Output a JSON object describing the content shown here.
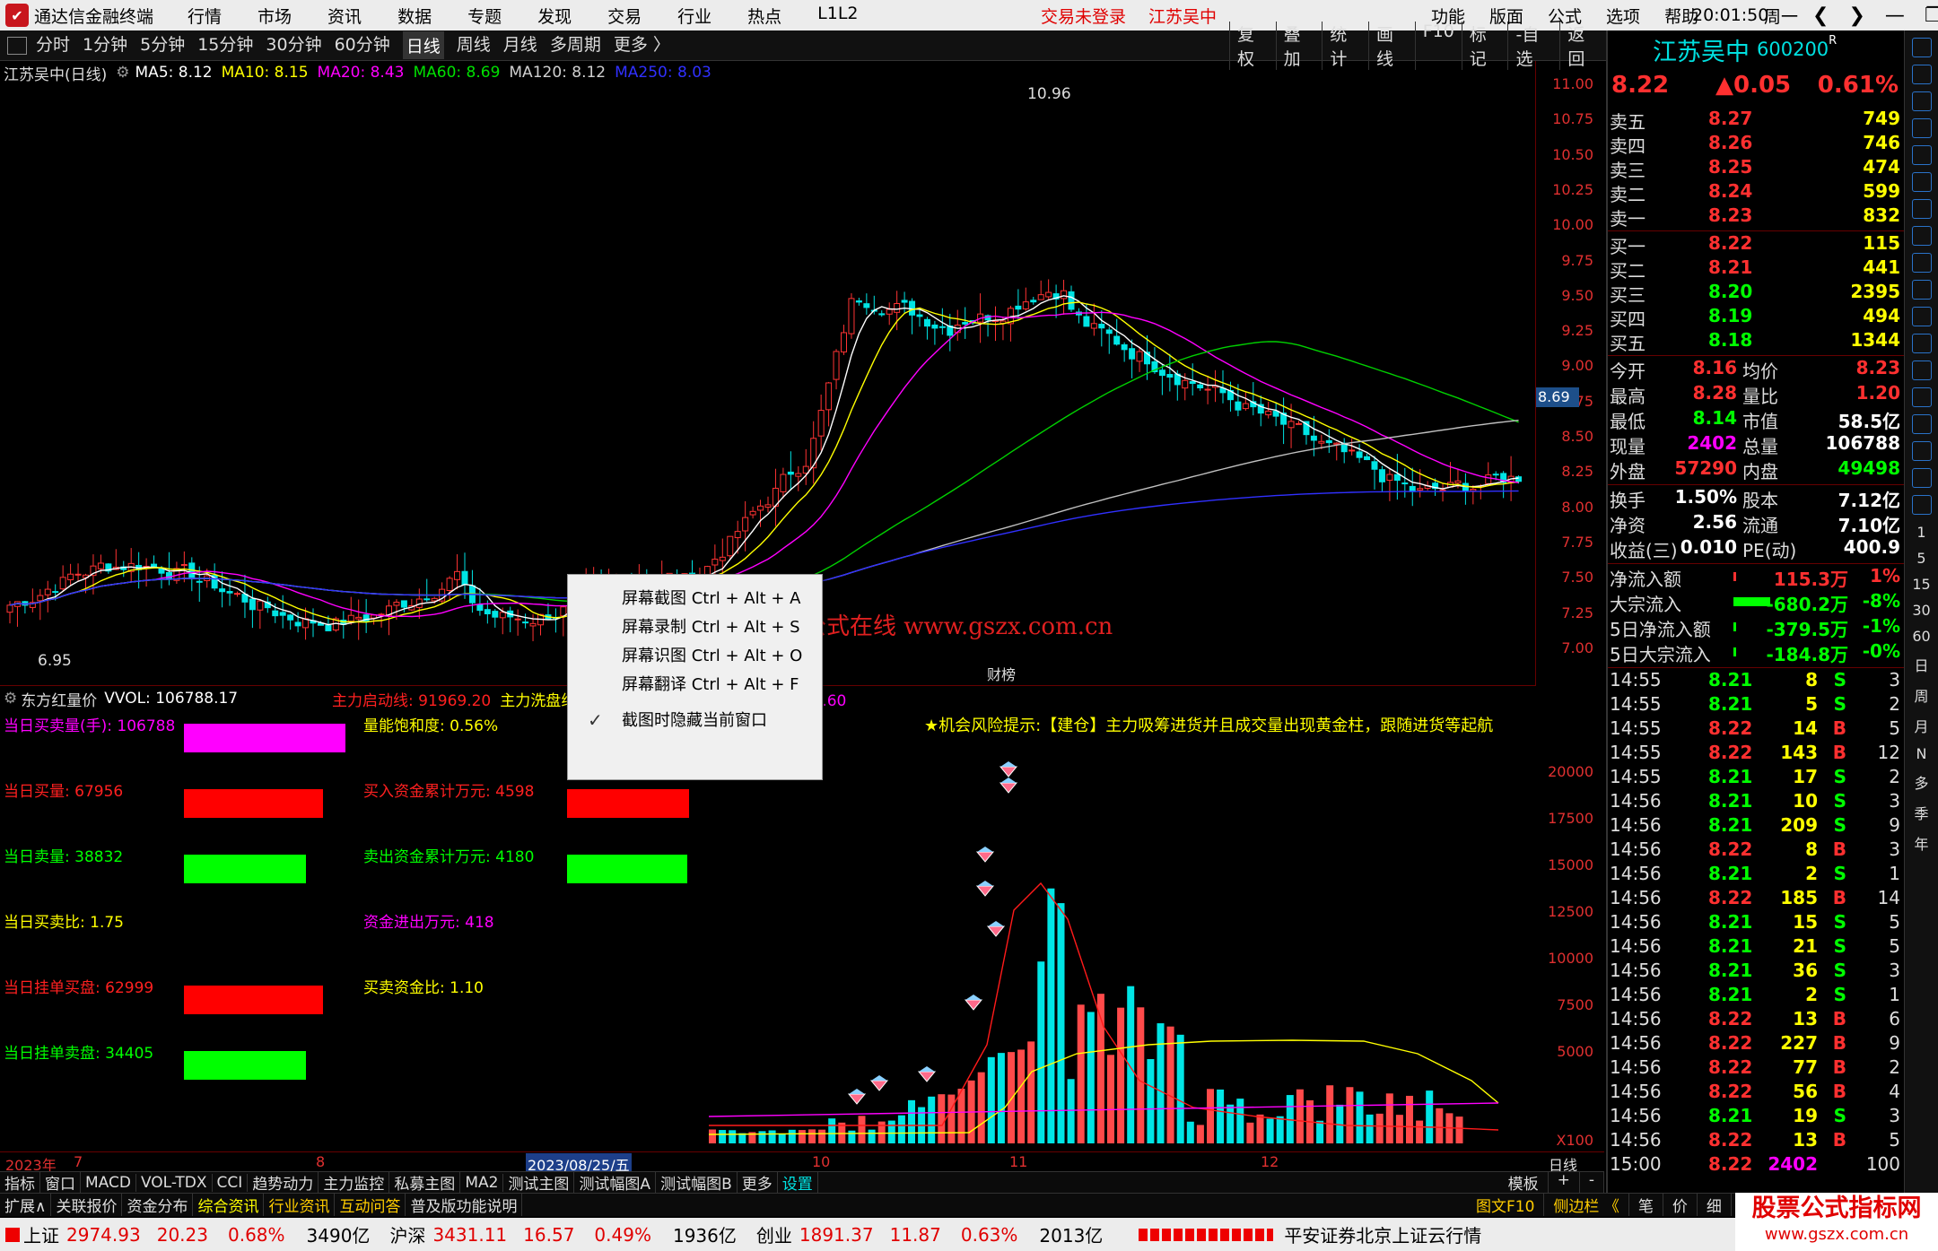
{
  "titlebar": {
    "app_name": "通达信金融终端",
    "menu": [
      "行情",
      "市场",
      "资讯",
      "数据",
      "专题",
      "发现",
      "交易",
      "行业",
      "热点",
      "L1L2"
    ],
    "login_status": "交易未登录",
    "stock_name": "江苏吴中",
    "right_menu": [
      "功能",
      "版面",
      "公式",
      "选项",
      "帮助"
    ],
    "time": "20:01:50",
    "weekday": "周一"
  },
  "toolbar": {
    "periods": [
      "分时",
      "1分钟",
      "5分钟",
      "15分钟",
      "30分钟",
      "60分钟",
      "日线",
      "周线",
      "月线",
      "多周期",
      "更多 〉"
    ],
    "active_period": "日线",
    "right_tools": [
      "复权",
      "叠加",
      "统计",
      "画线",
      "F10",
      "标记",
      "-自选",
      "返回"
    ]
  },
  "main_chart": {
    "title": "江苏吴中(日线)",
    "ma_labels": [
      {
        "text": "MA5: 8.12",
        "color": "#ffffff"
      },
      {
        "text": "MA10: 8.15",
        "color": "#ffff00"
      },
      {
        "text": "MA20: 8.43",
        "color": "#ff00ff"
      },
      {
        "text": "MA60: 8.69",
        "color": "#00e000"
      },
      {
        "text": "MA120: 8.12",
        "color": "#d0d0d0"
      },
      {
        "text": "MA250: 8.03",
        "color": "#3030ff"
      }
    ],
    "high_label": "10.96",
    "low_label": "6.95",
    "event_label": "财榜",
    "current_price_tag": "8.69"
  },
  "chart_data": {
    "type": "candlestick",
    "price_axis_ticks": [
      "11.00",
      "10.75",
      "10.50",
      "10.25",
      "10.00",
      "9.75",
      "9.50",
      "9.25",
      "9.00",
      "8.75",
      "8.50",
      "8.25",
      "8.00",
      "7.75",
      "7.50",
      "7.25",
      "7.00"
    ],
    "volume_axis_ticks": [
      "20000",
      "17500",
      "15000",
      "12500",
      "10000",
      "7500",
      "5000"
    ],
    "volume_unit": "X100",
    "date_labels": [
      "2023年",
      "7",
      "8",
      "2023/08/25/五",
      "10",
      "11",
      "12",
      "日线"
    ]
  },
  "sub_chart": {
    "title": "东方红量价",
    "vvol": "VVOL: 106788.17",
    "legend": [
      {
        "text": "主力启动线: 91969.20",
        "color": "#ff2020"
      },
      {
        "text": "主力洗盘线: 198363.23",
        "color": "#ffff00"
      },
      {
        "text": "洗盘结束线: 241170.60",
        "color": "#ff00ff"
      }
    ],
    "risk_tip": "★机会风险提示:【建仓】主力吸筹进货并且成交量出现黄金柱，跟随进货等起航",
    "stats_left": [
      {
        "label": "当日买卖量(手): 106788",
        "color": "#ff00ff",
        "bar": "#ff00ff"
      },
      {
        "label": "当日买量: 67956",
        "color": "#ff2020",
        "bar": "#ff0000"
      },
      {
        "label": "当日卖量: 38832",
        "color": "#00ff00",
        "bar": "#00ff00"
      },
      {
        "label": "当日买卖比: 1.75",
        "color": "#ffff00",
        "bar": ""
      },
      {
        "label": "当日挂单买盘: 62999",
        "color": "#ff2020",
        "bar": "#ff0000"
      },
      {
        "label": "当日挂单卖盘: 34405",
        "color": "#00ff00",
        "bar": "#00ff00"
      }
    ],
    "stats_mid": [
      {
        "label": "量能饱和度: 0.56%",
        "color": "#ffff00"
      },
      {
        "label": "买入资金累计万元: 4598",
        "color": "#ff2020"
      },
      {
        "label": "卖出资金累计万元: 4180",
        "color": "#00ff00"
      },
      {
        "label": "资金进出万元: 418",
        "color": "#ff00ff"
      },
      {
        "label": "买卖资金比: 1.10",
        "color": "#ffff00"
      }
    ]
  },
  "context_menu": {
    "items": [
      {
        "label": "屏幕截图 Ctrl + Alt + A"
      },
      {
        "label": "屏幕录制 Ctrl + Alt + S"
      },
      {
        "label": "屏幕识图 Ctrl + Alt + O"
      },
      {
        "label": "屏幕翻译 Ctrl + Alt + F"
      },
      {
        "label": "截图时隐藏当前窗口",
        "checked": true
      }
    ]
  },
  "watermark": "公式在线  www.gszx.com.cn",
  "tabs_row1": [
    "指标",
    "窗口",
    "MACD",
    "VOL-TDX",
    "CCI",
    "趋势动力",
    "主力监控",
    "私募主图",
    "MA2",
    "测试主图",
    "测试幅图A",
    "测试幅图B",
    "更多",
    "设置"
  ],
  "tabs_row1_right": [
    "模板",
    "+",
    "-"
  ],
  "tabs_row2": [
    "扩展∧",
    "关联报价",
    "资金分布",
    "综合资讯",
    "行业资讯",
    "互动问答",
    "普及版功能说明"
  ],
  "tabs_row2_right": [
    "图文F10",
    "侧边栏 《",
    "笔",
    "价",
    "细",
    "势"
  ],
  "statusbar": {
    "sh": {
      "name": "上证",
      "value": "2974.93",
      "chg": "20.23",
      "pct": "0.68%",
      "amt": "3490亿"
    },
    "hs": {
      "name": "沪深",
      "value": "3431.11",
      "chg": "16.57",
      "pct": "0.49%",
      "amt": "1936亿"
    },
    "cy": {
      "name": "创业",
      "value": "1891.37",
      "chg": "11.87",
      "pct": "0.63%",
      "amt": "2013亿"
    },
    "server": "平安证券北京上证云行情"
  },
  "corner_logo": {
    "line1": "股票公式指标网",
    "line2": "www.gszx.com.cn"
  },
  "quote": {
    "name": "江苏吴中",
    "code": "600200",
    "r": "R",
    "price": "8.22",
    "change": "▲0.05",
    "pct": "0.61%",
    "asks": [
      {
        "label": "卖五",
        "price": "8.27",
        "vol": "749"
      },
      {
        "label": "卖四",
        "price": "8.26",
        "vol": "746"
      },
      {
        "label": "卖三",
        "price": "8.25",
        "vol": "474"
      },
      {
        "label": "卖二",
        "price": "8.24",
        "vol": "599"
      },
      {
        "label": "卖一",
        "price": "8.23",
        "vol": "832"
      }
    ],
    "bids": [
      {
        "label": "买一",
        "price": "8.22",
        "vol": "115"
      },
      {
        "label": "买二",
        "price": "8.21",
        "vol": "441"
      },
      {
        "label": "买三",
        "price": "8.20",
        "vol": "2395"
      },
      {
        "label": "买四",
        "price": "8.19",
        "vol": "494"
      },
      {
        "label": "买五",
        "price": "8.18",
        "vol": "1344"
      }
    ],
    "stats1": [
      {
        "l1": "今开",
        "v1": "8.16",
        "c1": "#ff3030",
        "l2": "均价",
        "v2": "8.23",
        "c2": "#ff3030"
      },
      {
        "l1": "最高",
        "v1": "8.28",
        "c1": "#ff3030",
        "l2": "量比",
        "v2": "1.20",
        "c2": "#ff3030"
      },
      {
        "l1": "最低",
        "v1": "8.14",
        "c1": "#00ff00",
        "l2": "市值",
        "v2": "58.5亿",
        "c2": "#ffffff"
      },
      {
        "l1": "现量",
        "v1": "2402",
        "c1": "#ff00ff",
        "l2": "总量",
        "v2": "106788",
        "c2": "#ffffff"
      },
      {
        "l1": "外盘",
        "v1": "57290",
        "c1": "#ff3030",
        "l2": "内盘",
        "v2": "49498",
        "c2": "#00ff00"
      }
    ],
    "stats2": [
      {
        "l1": "换手",
        "v1": "1.50%",
        "c1": "#ffffff",
        "l2": "股本",
        "v2": "7.12亿",
        "c2": "#ffffff"
      },
      {
        "l1": "净资",
        "v1": "2.56",
        "c1": "#ffffff",
        "l2": "流通",
        "v2": "7.10亿",
        "c2": "#ffffff"
      },
      {
        "l1": "收益(三)",
        "v1": "0.010",
        "c1": "#ffffff",
        "l2": "PE(动)",
        "v2": "400.9",
        "c2": "#ffffff"
      }
    ],
    "flows": [
      {
        "label": "净流入额",
        "value": "115.3万",
        "pct": "1%",
        "color": "#ff3030",
        "bar": 0.05
      },
      {
        "label": "大宗流入",
        "value": "-680.2万",
        "pct": "-8%",
        "color": "#00ff00",
        "bar": 0.75
      },
      {
        "label": "5日净流入额",
        "value": "-379.5万",
        "pct": "-1%",
        "color": "#00ff00",
        "bar": 0.06
      },
      {
        "label": "5日大宗流入",
        "value": "-184.8万",
        "pct": "-0%",
        "color": "#00ff00",
        "bar": 0.06
      }
    ],
    "ticks": [
      {
        "t": "14:55",
        "p": "8.21",
        "v": "8",
        "d": "S",
        "n": "3"
      },
      {
        "t": "14:55",
        "p": "8.21",
        "v": "5",
        "d": "S",
        "n": "2"
      },
      {
        "t": "14:55",
        "p": "8.22",
        "v": "14",
        "d": "B",
        "n": "5"
      },
      {
        "t": "14:55",
        "p": "8.22",
        "v": "143",
        "d": "B",
        "n": "12"
      },
      {
        "t": "14:55",
        "p": "8.21",
        "v": "17",
        "d": "S",
        "n": "2"
      },
      {
        "t": "14:56",
        "p": "8.21",
        "v": "10",
        "d": "S",
        "n": "3"
      },
      {
        "t": "14:56",
        "p": "8.21",
        "v": "209",
        "d": "S",
        "n": "9"
      },
      {
        "t": "14:56",
        "p": "8.22",
        "v": "8",
        "d": "B",
        "n": "3"
      },
      {
        "t": "14:56",
        "p": "8.21",
        "v": "2",
        "d": "S",
        "n": "1"
      },
      {
        "t": "14:56",
        "p": "8.22",
        "v": "185",
        "d": "B",
        "n": "14"
      },
      {
        "t": "14:56",
        "p": "8.21",
        "v": "15",
        "d": "S",
        "n": "5"
      },
      {
        "t": "14:56",
        "p": "8.21",
        "v": "21",
        "d": "S",
        "n": "5"
      },
      {
        "t": "14:56",
        "p": "8.21",
        "v": "36",
        "d": "S",
        "n": "3"
      },
      {
        "t": "14:56",
        "p": "8.21",
        "v": "2",
        "d": "S",
        "n": "1"
      },
      {
        "t": "14:56",
        "p": "8.22",
        "v": "13",
        "d": "B",
        "n": "6"
      },
      {
        "t": "14:56",
        "p": "8.22",
        "v": "227",
        "d": "B",
        "n": "9"
      },
      {
        "t": "14:56",
        "p": "8.22",
        "v": "77",
        "d": "B",
        "n": "2"
      },
      {
        "t": "14:56",
        "p": "8.22",
        "v": "56",
        "d": "B",
        "n": "4"
      },
      {
        "t": "14:56",
        "p": "8.21",
        "v": "19",
        "d": "S",
        "n": "3"
      },
      {
        "t": "14:56",
        "p": "8.22",
        "v": "13",
        "d": "B",
        "n": "5"
      },
      {
        "t": "15:00",
        "p": "8.22",
        "v": "2402",
        "d": "",
        "n": "100"
      }
    ]
  },
  "side_periods": [
    "1",
    "5",
    "15",
    "30",
    "60",
    "日",
    "周",
    "月",
    "N",
    "多",
    "季",
    "年"
  ]
}
